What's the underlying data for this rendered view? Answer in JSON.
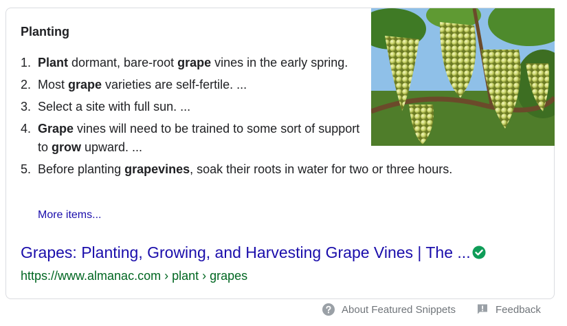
{
  "snippet": {
    "heading": "Planting",
    "steps": [
      {
        "number": "1.",
        "parts": [
          {
            "text": "Plant",
            "bold": true
          },
          {
            "text": " dormant, bare-root ",
            "bold": false
          },
          {
            "text": "grape",
            "bold": true
          },
          {
            "text": " vines in the early spring.",
            "bold": false
          }
        ]
      },
      {
        "number": "2.",
        "parts": [
          {
            "text": "Most ",
            "bold": false
          },
          {
            "text": "grape",
            "bold": true
          },
          {
            "text": " varieties are self-fertile. ...",
            "bold": false
          }
        ]
      },
      {
        "number": "3.",
        "parts": [
          {
            "text": "Select a site with full sun. ...",
            "bold": false
          }
        ]
      },
      {
        "number": "4.",
        "parts": [
          {
            "text": "Grape",
            "bold": true
          },
          {
            "text": " vines will need to be trained to some sort of support to ",
            "bold": false
          },
          {
            "text": "grow",
            "bold": true
          },
          {
            "text": " upward. ...",
            "bold": false
          }
        ]
      },
      {
        "number": "5.",
        "parts": [
          {
            "text": "Before planting ",
            "bold": false
          },
          {
            "text": "grapevines",
            "bold": true
          },
          {
            "text": ", soak their roots in water for two or three hours.",
            "bold": false
          }
        ]
      }
    ],
    "more_items_label": "More items...",
    "image_icon": "grape-vines-photo"
  },
  "result": {
    "title": "Grapes: Planting, Growing, and Harvesting Grape Vines | The ...",
    "verified_icon": "check-circle-icon",
    "url": "https://www.almanac.com › plant › grapes"
  },
  "footer": {
    "about_label": "About Featured Snippets",
    "about_icon": "help-circle-icon",
    "feedback_label": "Feedback",
    "feedback_icon": "feedback-icon"
  },
  "colors": {
    "link": "#1a0dab",
    "url_green": "#006621",
    "verified_green": "#0f9d58",
    "muted": "#70757a"
  }
}
